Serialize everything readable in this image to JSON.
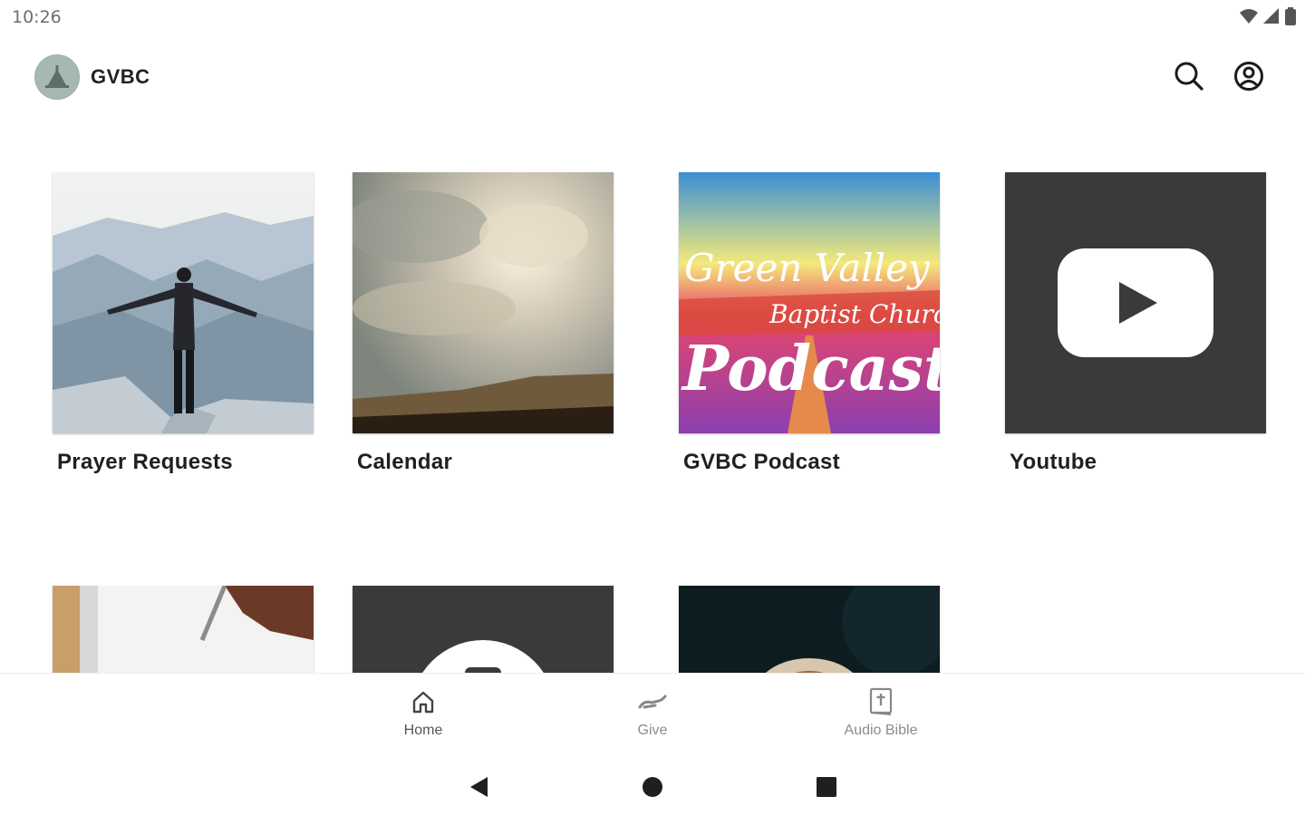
{
  "status_bar": {
    "time": "10:26"
  },
  "header": {
    "app_name": "GVBC"
  },
  "tiles_row1": [
    {
      "label": "Prayer Requests"
    },
    {
      "label": "Calendar"
    },
    {
      "label": "GVBC Podcast",
      "artwork_text": [
        "Green Valley",
        "Baptist Church",
        "Podcast"
      ]
    },
    {
      "label": "Youtube"
    }
  ],
  "bottom_nav": [
    {
      "label": "Home",
      "icon": "home-icon",
      "active": true
    },
    {
      "label": "Give",
      "icon": "give-icon",
      "active": false
    },
    {
      "label": "Audio Bible",
      "icon": "bible-icon",
      "active": false
    }
  ],
  "colors": {
    "dark_tile": "#3a3a3a",
    "accent": "#222222"
  }
}
